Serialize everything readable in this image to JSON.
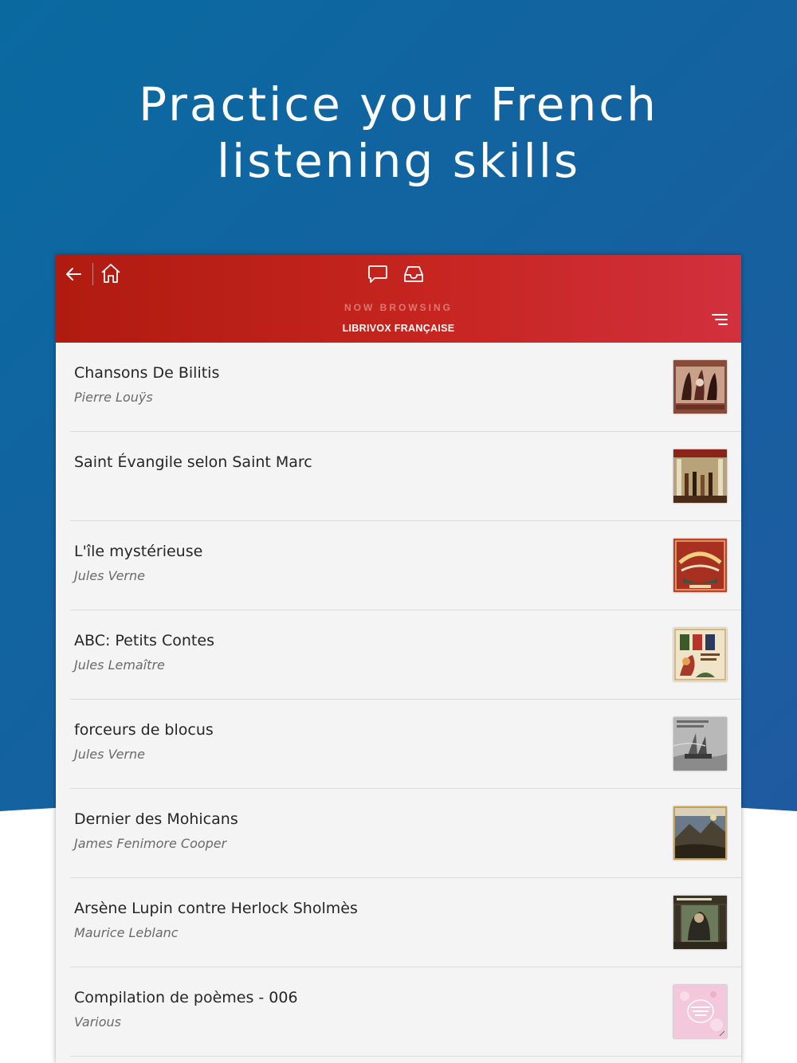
{
  "hero": {
    "line1": "Practice your French",
    "line2": "listening skills"
  },
  "appbar": {
    "icons": [
      "back-arrow-icon",
      "home-icon",
      "chat-bubble-icon",
      "inbox-icon",
      "menu-lines-icon"
    ],
    "now_browsing_label": "NOW BROWSING",
    "collection_name": "LIBRIVOX FRANÇAISE"
  },
  "colors": {
    "hero_blue": "#0a6aa0",
    "appbar_red_start": "#b01b10",
    "appbar_red_end": "#d2303d",
    "list_bg": "#f4f4f4"
  },
  "books": [
    {
      "title": "Chansons De Bilitis",
      "author": "Pierre Louÿs",
      "cover": "bilitis"
    },
    {
      "title": "Saint Évangile selon Saint Marc",
      "author": "",
      "cover": "marc"
    },
    {
      "title": "L'île mystérieuse",
      "author": "Jules Verne",
      "cover": "ile"
    },
    {
      "title": "ABC: Petits Contes",
      "author": "Jules Lemaître",
      "cover": "abc"
    },
    {
      "title": "forceurs de blocus",
      "author": "Jules Verne",
      "cover": "blocus"
    },
    {
      "title": "Dernier des Mohicans",
      "author": "James Fenimore Cooper",
      "cover": "mohicans"
    },
    {
      "title": "Arsène Lupin contre Herlock Sholmès",
      "author": "Maurice Leblanc",
      "cover": "lupin"
    },
    {
      "title": "Compilation de poèmes - 006",
      "author": "Various",
      "cover": "poemes"
    }
  ]
}
